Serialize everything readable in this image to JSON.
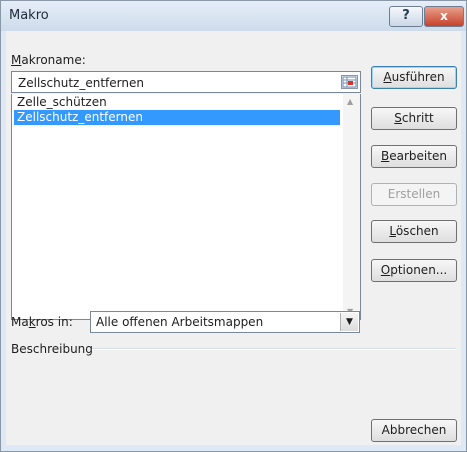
{
  "window": {
    "title": "Makro"
  },
  "titlebar": {
    "help": "?",
    "close": "x"
  },
  "macro_name": {
    "label_accel": "M",
    "label_rest": "akroname:",
    "value": "Zellschutz_entfernen"
  },
  "macro_list": {
    "items": [
      "Zelle_schützen",
      "Zellschutz_entfernen"
    ],
    "selected_index": 1
  },
  "buttons": {
    "run": {
      "accel": "A",
      "rest": "usführen"
    },
    "step": {
      "accel": "S",
      "rest": "chritt"
    },
    "edit": {
      "accel": "B",
      "rest": "earbeiten"
    },
    "create": "Erstellen",
    "delete": {
      "accel": "L",
      "rest": "öschen"
    },
    "options": {
      "accel": "O",
      "rest": "ptionen..."
    },
    "cancel": "Abbrechen"
  },
  "macros_in": {
    "label_pre": "Ma",
    "label_accel": "k",
    "label_post": "ros in:",
    "value": "Alle offenen Arbeitsmappen"
  },
  "description": {
    "label": "Beschreibung"
  }
}
